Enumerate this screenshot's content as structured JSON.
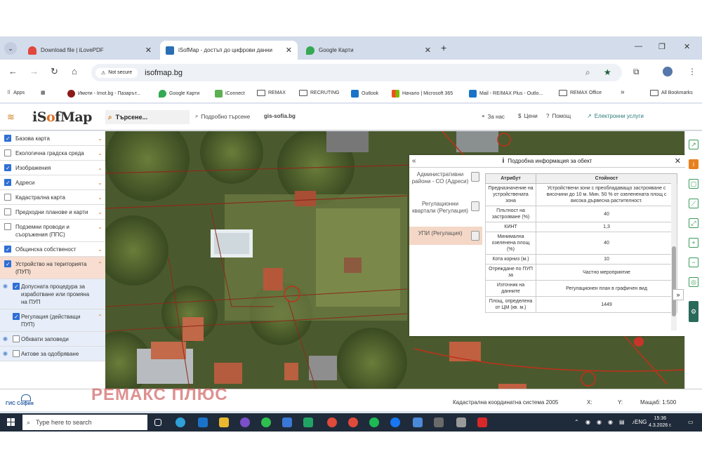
{
  "browser": {
    "tabs": [
      {
        "label": "Download file | iLovePDF",
        "color": "#e0483e",
        "active": false
      },
      {
        "label": "iSofMap - достъп до цифрови данни",
        "color": "#2a6fb5",
        "active": true
      },
      {
        "label": "Google Карти",
        "color": "#34a853",
        "active": false
      }
    ],
    "new_tab_symbol": "+",
    "not_secure": "Not secure",
    "url": "isofmap.bg",
    "bookmarks": [
      {
        "label": "Apps",
        "kind": "apps"
      },
      {
        "label": "Имоти - Imot.bg - Пазарът...",
        "kind": "site",
        "color": "#8b1a1a"
      },
      {
        "label": "Google Карти",
        "kind": "site",
        "color": "#34a853"
      },
      {
        "label": "iConnect",
        "kind": "site",
        "color": "#5bb04f"
      },
      {
        "label": "REMAX",
        "kind": "folder"
      },
      {
        "label": "RECRUTING",
        "kind": "folder"
      },
      {
        "label": "Outlook",
        "kind": "site",
        "color": "#1a73c8"
      },
      {
        "label": "Начало | Microsoft 365",
        "kind": "site",
        "color": "#e74c3c"
      },
      {
        "label": "Mail - RE/MAX Plus - Outlo...",
        "kind": "site",
        "color": "#1a73c8"
      },
      {
        "label": "REMAX Office",
        "kind": "folder"
      }
    ],
    "bookmarks_more": "»",
    "all_bookmarks": "All Bookmarks"
  },
  "app": {
    "logo": {
      "prefix": "iS",
      "o": "o",
      "suffix": "fMap"
    },
    "search_placeholder": "Търсене...",
    "advanced_search": "Подробно търсене",
    "gis_link": "gis-sofia.bg",
    "about": "За нас",
    "prices": "Цени",
    "help": "Помощ",
    "e_services": "Електронни услуги"
  },
  "layers": [
    {
      "label": "Базова карта",
      "checked": true,
      "chev": "⌄"
    },
    {
      "label": "Екологична градска среда",
      "checked": false,
      "chev": "⌄"
    },
    {
      "label": "Изображения",
      "checked": true,
      "chev": "⌄"
    },
    {
      "label": "Адреси",
      "checked": true,
      "chev": "⌄"
    },
    {
      "label": "Кадастрална карта",
      "checked": false,
      "chev": "⌄"
    },
    {
      "label": "Предходни планове и карти",
      "checked": false,
      "chev": "⌄"
    },
    {
      "label": "Подземни проводи и съоръжения (ППС)",
      "checked": false,
      "chev": "⌄"
    },
    {
      "label": "Общинска собственост",
      "checked": true,
      "chev": "⌄"
    },
    {
      "label": "Устройство на територията (ПУП)",
      "checked": true,
      "chev": "⌃",
      "highlight": true
    }
  ],
  "sublayers": [
    {
      "label": "Допусната процедура за изработване или промяна на ПУП",
      "checked": true,
      "eye": true
    },
    {
      "label": "Регулация (действащи ПУП)",
      "checked": true,
      "highlight": true,
      "chev": "⌃"
    },
    {
      "label": "Обхвати заповеди",
      "checked": false,
      "eye": true
    },
    {
      "label": "Актове за одобряване",
      "checked": false,
      "eye": true
    }
  ],
  "info_panel": {
    "title": "Подробна информация за обект",
    "categories": [
      {
        "label": "Административни райони - СО (Адреси)",
        "active": false
      },
      {
        "label": "Регулационни квартали (Регулация)",
        "active": false
      },
      {
        "label": "УПИ (Регулация)",
        "active": true
      }
    ],
    "headers": {
      "attribute": "Атрибут",
      "value": "Стойност"
    },
    "rows": [
      {
        "attr": "Предназначение на устройствената зона",
        "value": "Устройствени зони с преобладаващо застрояване с височини до 10 м. Мин. 50 % от озеленената площ с висока дървесна растителност."
      },
      {
        "attr": "Плътност на застрояване (%)",
        "value": "40"
      },
      {
        "attr": "КИНТ",
        "value": "1,3"
      },
      {
        "attr": "Минимална озеленена площ (%)",
        "value": "40"
      },
      {
        "attr": "Кота корниз (м.)",
        "value": "10"
      },
      {
        "attr": "Отреждане по ПУП за",
        "value": "Частно мероприятие"
      },
      {
        "attr": "Източник на данните",
        "value": "Регулационен план в графичен вид"
      },
      {
        "attr": "Площ, определена от ЦМ (кв. м.)",
        "value": "1449"
      }
    ]
  },
  "statusbar": {
    "gis_logo_line1": "ГИС",
    "gis_logo_line2": "София",
    "watermark": "РЕМАКС ПЛЮС",
    "coord_system": "Кадастрална координатна система 2005",
    "x_label": "X:",
    "y_label": "Y:",
    "scale": "Мащаб: 1:500"
  },
  "taskbar": {
    "search_placeholder": "Type here to search",
    "lang": "ENG",
    "time": "15:36",
    "date": "4.3.2026 г."
  }
}
